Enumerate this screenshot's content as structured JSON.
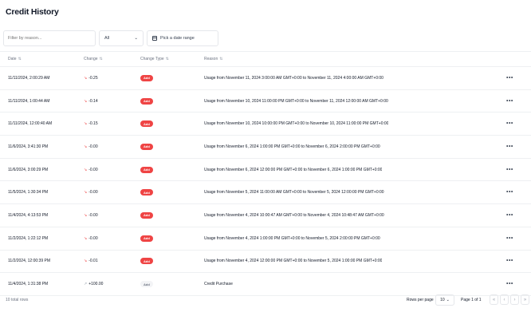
{
  "page": {
    "title": "Credit History"
  },
  "filters": {
    "search_placeholder": "Filter by reason...",
    "type_select": "All",
    "date_button": "Pick a date range"
  },
  "table": {
    "columns": [
      "Date",
      "Change",
      "Change Type",
      "Reason"
    ],
    "rows": [
      {
        "date": "11/11/2024, 2:00:29 AM",
        "change": "-0.25",
        "dir": "down",
        "type": "Add",
        "reason": "Usage from November 11, 2024 3:00:00 AM GMT+0:00 to November 11, 2024 4:00:00 AM GMT+0:00"
      },
      {
        "date": "11/11/2024, 1:00:44 AM",
        "change": "-0.14",
        "dir": "down",
        "type": "Add",
        "reason": "Usage from November 10, 2024 11:00:00 PM GMT+0:00 to November 11, 2024 12:00:00 AM GMT+0:00"
      },
      {
        "date": "11/11/2024, 12:00:40 AM",
        "change": "-0.15",
        "dir": "down",
        "type": "Add",
        "reason": "Usage from November 10, 2024 10:00:00 PM GMT+0:00 to November 10, 2024 11:00:00 PM GMT+0:00"
      },
      {
        "date": "11/6/2024, 3:41:30 PM",
        "change": "-0.00",
        "dir": "down",
        "type": "Add",
        "reason": "Usage from November 6, 2024 1:00:00 PM GMT+0:00 to November 6, 2024 2:00:00 PM GMT+0:00"
      },
      {
        "date": "11/6/2024, 3:00:29 PM",
        "change": "-0.00",
        "dir": "down",
        "type": "Add",
        "reason": "Usage from November 6, 2024 12:00:00 PM GMT+0:00 to November 6, 2024 1:00:00 PM GMT+0:00"
      },
      {
        "date": "11/5/2024, 1:30:34 PM",
        "change": "-0.00",
        "dir": "down",
        "type": "Add",
        "reason": "Usage from November 5, 2024 11:00:00 AM GMT+0:00 to November 5, 2024 12:00:00 PM GMT+0:00"
      },
      {
        "date": "11/4/2024, 4:13:53 PM",
        "change": "-0.00",
        "dir": "down",
        "type": "Add",
        "reason": "Usage from November 4, 2024 10:00:47 AM GMT+0:00 to November 4, 2024 10:48:47 AM GMT+0:00"
      },
      {
        "date": "11/2/2024, 1:22:12 PM",
        "change": "-0.00",
        "dir": "down",
        "type": "Add",
        "reason": "Usage from November 4, 2024 1:00:00 PM GMT+0:00 to November 5, 2024 2:00:00 PM GMT+0:00"
      },
      {
        "date": "11/2/2024, 12:00:39 PM",
        "change": "-0.01",
        "dir": "down",
        "type": "Add",
        "reason": "Usage from November 4, 2024 12:00:00 PM GMT+0:00 to November 5, 2024 1:00:00 PM GMT+0:00"
      },
      {
        "date": "11/4/2024, 1:31:38 PM",
        "change": "+100.00",
        "dir": "up",
        "type": "Add",
        "reason": "Credit Purchase"
      }
    ]
  },
  "footer": {
    "rows_total": "10 total rows",
    "rows_per_page_label": "Rows per page",
    "rows_per_page_value": "10",
    "page_info": "Page 1 of 1"
  }
}
